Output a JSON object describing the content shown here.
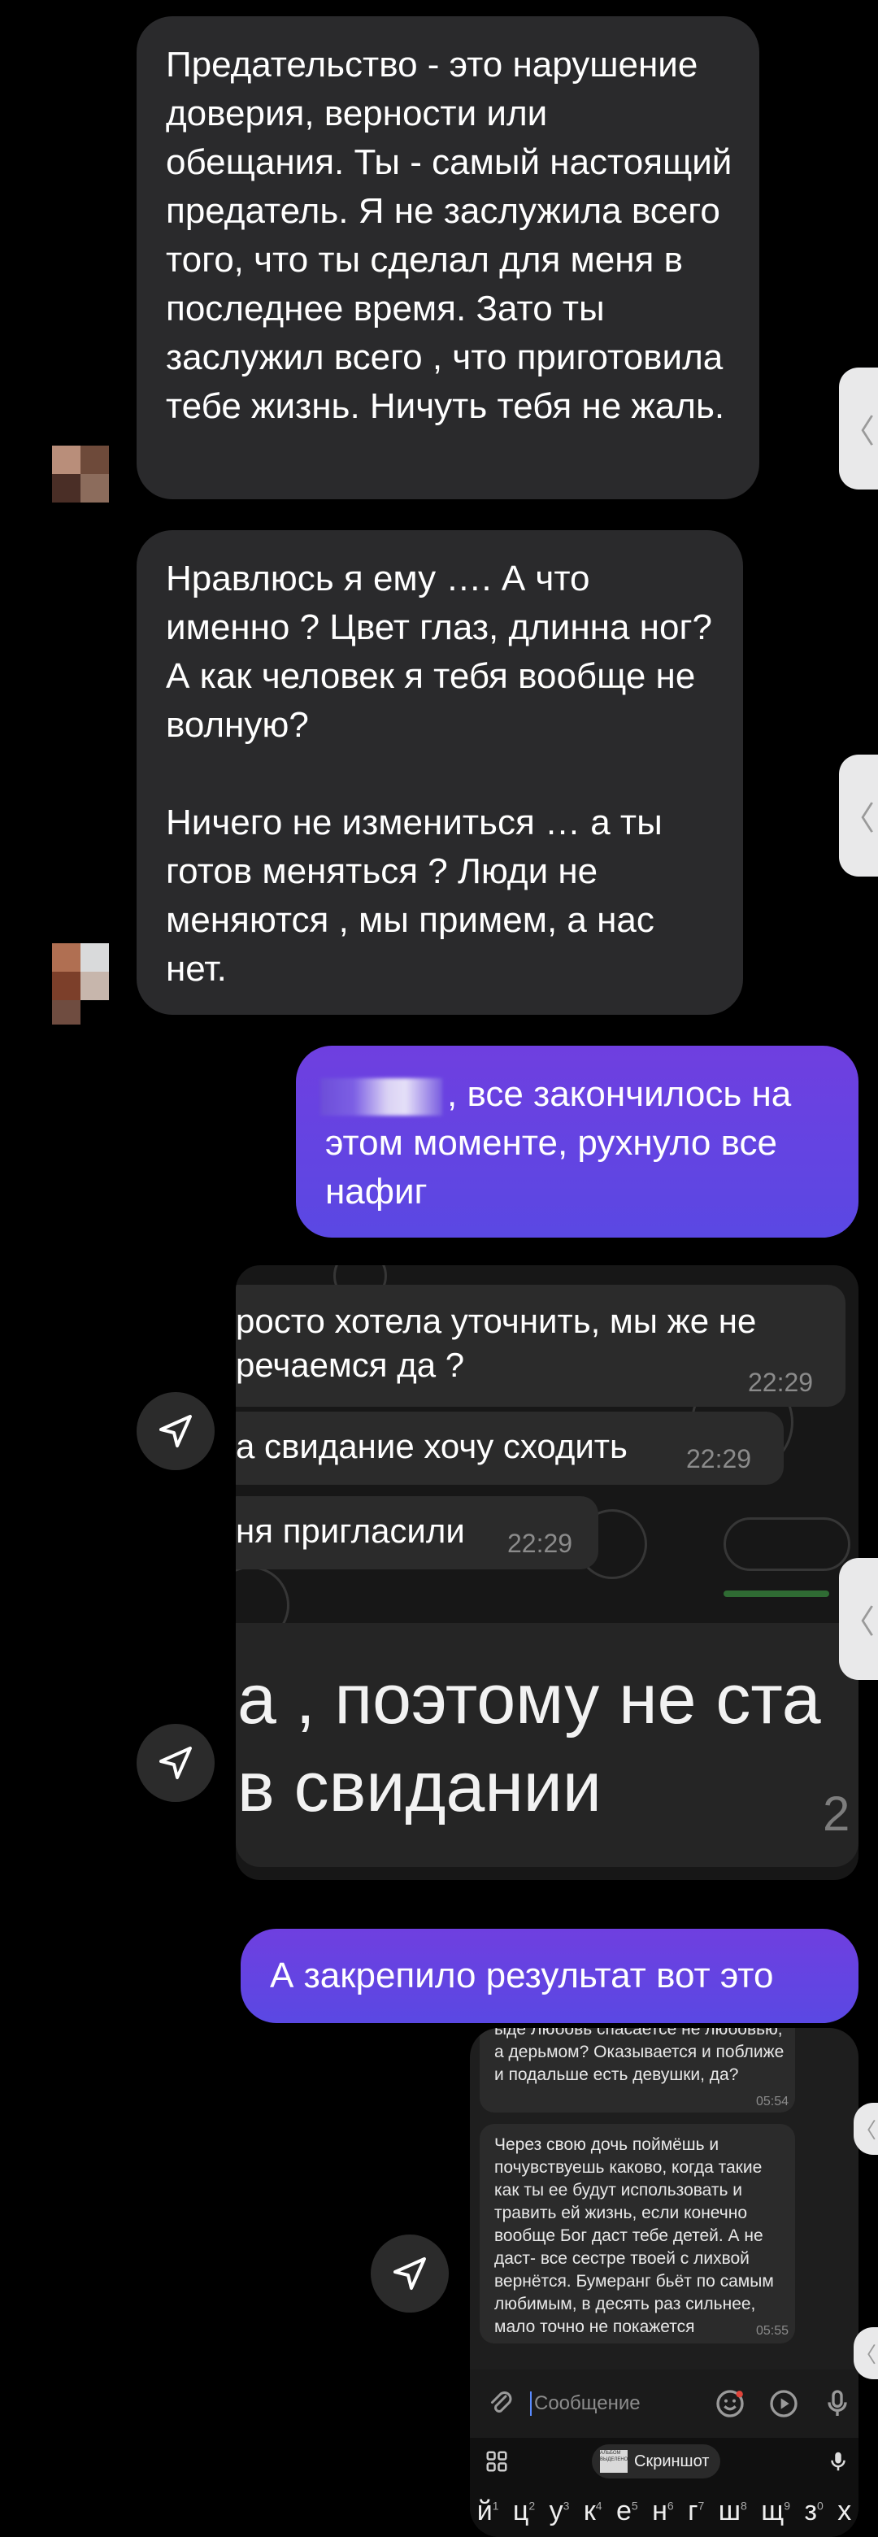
{
  "messages": {
    "incoming_1": "Предательство - это нарушение доверия, верности или обещания. Ты - самый настоящий предатель. Я не заслужила всего того, что ты сделал для меня в последнее время. Зато ты заслужил всего , что приготовила тебе жизнь. Ничуть тебя не жаль.",
    "incoming_2": "Нравлюсь я ему …. А что именно ? Цвет глаз, длинна ног? А как человек я тебя вообще не волную?\n\nНичего не измениться … а ты готов меняться ? Люди не меняются , мы примем, а нас нет.",
    "outgoing_1": ", все закончилось на этом моменте, рухнуло все нафиг",
    "outgoing_2": "А закрепило результат вот это"
  },
  "shared_screenshot_1": {
    "lines": [
      {
        "text": "росто хотела уточнить, мы же не\nречаемся да ?",
        "time": "22:29"
      },
      {
        "text": "а свидание хочу сходить",
        "time": "22:29"
      },
      {
        "text": "ня пригласили",
        "time": "22:29"
      }
    ]
  },
  "shared_screenshot_2": {
    "text": "а , поэтому не ста\nв свидании",
    "partial_time": "2"
  },
  "shared_screenshot_3": {
    "bubble_1_text": "ыдё Любовь спасаетсе не любовью, а дерьмом? Оказывается и поближе и подальше есть девушки, да?",
    "bubble_1_time": "05:54",
    "bubble_2_text": "Через свою дочь поймёшь и почувствуешь каково, когда такие как ты ее будут использовать и травить ей жизнь, если конечно вообще  Бог даст тебе детей. А не даст- все сестре твоей с лихвой вернётся. Бумеранг бьёт по самым любимым, в десять раз сильнее, мало точно не покажется",
    "bubble_2_time": "05:55",
    "input_placeholder": "Сообщение",
    "suggestion_chip_label": "Скриншот",
    "suggestion_thumb_text": "АЛЬБОМ ВЫДЕЛЕНО",
    "keyboard_row": [
      {
        "key": "й",
        "hint": "1"
      },
      {
        "key": "ц",
        "hint": "2"
      },
      {
        "key": "у",
        "hint": "3"
      },
      {
        "key": "к",
        "hint": "4"
      },
      {
        "key": "е",
        "hint": "5"
      },
      {
        "key": "н",
        "hint": "6"
      },
      {
        "key": "г",
        "hint": "7"
      },
      {
        "key": "ш",
        "hint": "8"
      },
      {
        "key": "щ",
        "hint": "9"
      },
      {
        "key": "з",
        "hint": "0"
      },
      {
        "key": "х",
        "hint": ""
      }
    ]
  },
  "edge_tab_glyph": "〈",
  "icons": [
    "send-arrow-icon",
    "paperclip-icon",
    "emoji-icon",
    "play-icon",
    "microphone-icon",
    "apps-grid-icon",
    "chevron-left-icon"
  ],
  "colors": {
    "background": "#000000",
    "incoming_bubble": "#2a2a2c",
    "outgoing_bubble_top": "#6f3fe0",
    "outgoing_bubble_bottom": "#5a48e3",
    "text": "#ffffff",
    "timestamp": "#8b8b8b"
  }
}
